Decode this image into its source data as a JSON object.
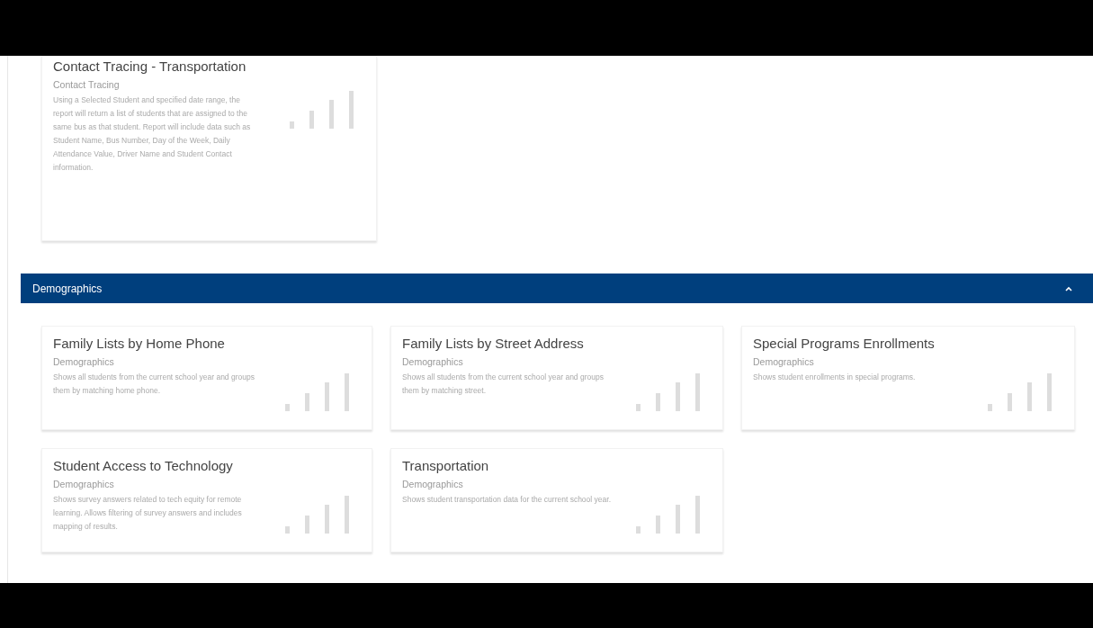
{
  "top_card": {
    "title": "Contact Tracing - Transportation",
    "category": "Contact Tracing",
    "description": "Using a Selected Student and specified date range, the report will return a list of students that are assigned to the same bus as that student. Report will include data such as Student Name, Bus Number, Day of the Week, Daily Attendance Value, Driver Name and Student Contact information."
  },
  "section": {
    "title": "Demographics",
    "expanded": true
  },
  "cards": [
    {
      "title": "Family Lists by Home Phone",
      "category": "Demographics",
      "description": "Shows all students from the current school year and groups them by matching home phone."
    },
    {
      "title": "Family Lists by Street Address",
      "category": "Demographics",
      "description": "Shows all students from the current school year and groups them by matching street."
    },
    {
      "title": "Special Programs Enrollments",
      "category": "Demographics",
      "description": "Shows student enrollments in special programs."
    },
    {
      "title": "Student Access to Technology",
      "category": "Demographics",
      "description": "Shows survey answers related to tech equity for remote learning. Allows filtering of survey answers and includes mapping of results."
    },
    {
      "title": "Transportation",
      "category": "Demographics",
      "description": "Shows student transportation data for the current school year."
    }
  ]
}
